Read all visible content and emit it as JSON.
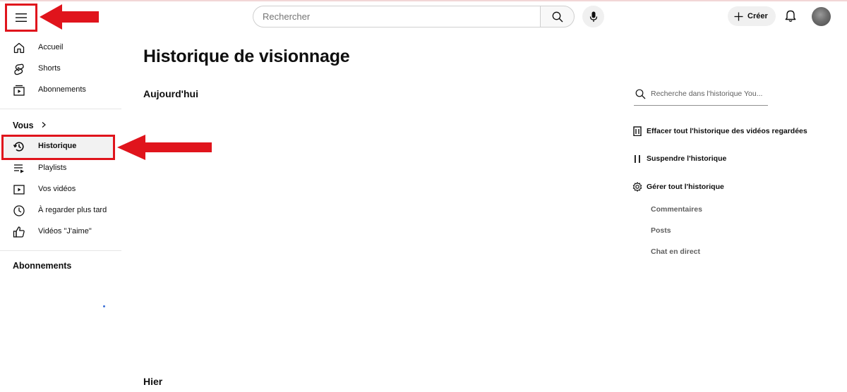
{
  "header": {
    "search_placeholder": "Rechercher",
    "create_label": "Créer",
    "menu_icon": "hamburger-menu-icon",
    "search_icon": "search-icon",
    "mic_icon": "microphone-icon",
    "bell_icon": "notification-bell-icon"
  },
  "sidebar": {
    "main_items": [
      {
        "label": "Accueil",
        "icon": "home-icon"
      },
      {
        "label": "Shorts",
        "icon": "shorts-icon"
      },
      {
        "label": "Abonnements",
        "icon": "subscriptions-icon"
      }
    ],
    "you_title": "Vous",
    "you_items": [
      {
        "label": "Historique",
        "icon": "history-icon",
        "selected": true
      },
      {
        "label": "Playlists",
        "icon": "playlists-icon"
      },
      {
        "label": "Vos vidéos",
        "icon": "your-videos-icon"
      },
      {
        "label": "À regarder plus tard",
        "icon": "watch-later-icon"
      },
      {
        "label": "Vidéos \"J'aime\"",
        "icon": "like-icon"
      }
    ],
    "subscriptions_title": "Abonnements"
  },
  "main": {
    "title": "Historique de visionnage",
    "groups": [
      "Aujourd'hui",
      "Hier"
    ]
  },
  "history_panel": {
    "search_placeholder": "Recherche dans l'historique You...",
    "clear_label": "Effacer tout l'historique des vidéos regardées",
    "pause_label": "Suspendre l'historique",
    "manage_label": "Gérer tout l'historique",
    "links": [
      "Commentaires",
      "Posts",
      "Chat en direct"
    ]
  },
  "annotations": {
    "highlight_color": "#e0141c"
  }
}
